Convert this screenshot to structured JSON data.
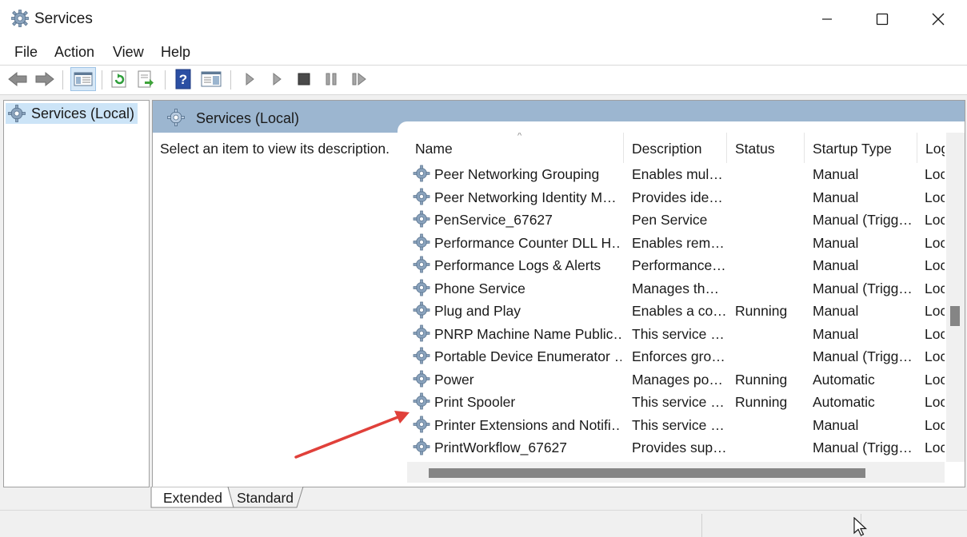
{
  "window": {
    "title": "Services",
    "title_icon": "gear-icon",
    "controls": [
      "minimize",
      "maximize",
      "close"
    ]
  },
  "menu": {
    "items": [
      {
        "label": "File"
      },
      {
        "label": "Action"
      },
      {
        "label": "View"
      },
      {
        "label": "Help"
      }
    ]
  },
  "toolbar": {
    "buttons": [
      "back-arrow-icon",
      "forward-arrow-icon",
      "show-hide-console-tree-icon",
      "refresh-icon",
      "export-list-icon",
      "help-icon",
      "properties-icon",
      "start-service-icon",
      "start-service-alt-icon",
      "stop-service-icon",
      "pause-service-icon",
      "resume-service-icon"
    ]
  },
  "tree": {
    "selected_label": "Services (Local)"
  },
  "main": {
    "header_label": "Services (Local)",
    "description_text": "Select an item to view its description.",
    "columns": {
      "name": "Name",
      "description": "Description",
      "status": "Status",
      "startup": "Startup Type",
      "logon": "Log"
    },
    "rows": [
      {
        "name": "Peer Networking Grouping",
        "description": "Enables mul…",
        "status": "",
        "startup": "Manual",
        "logon": "Loc"
      },
      {
        "name": "Peer Networking Identity M…",
        "description": "Provides ide…",
        "status": "",
        "startup": "Manual",
        "logon": "Loc"
      },
      {
        "name": "PenService_67627",
        "description": "Pen Service",
        "status": "",
        "startup": "Manual (Trigg…",
        "logon": "Loc"
      },
      {
        "name": "Performance Counter DLL H…",
        "description": "Enables rem…",
        "status": "",
        "startup": "Manual",
        "logon": "Loc"
      },
      {
        "name": "Performance Logs & Alerts",
        "description": "Performance…",
        "status": "",
        "startup": "Manual",
        "logon": "Loc"
      },
      {
        "name": "Phone Service",
        "description": "Manages th…",
        "status": "",
        "startup": "Manual (Trigg…",
        "logon": "Loc"
      },
      {
        "name": "Plug and Play",
        "description": "Enables a co…",
        "status": "Running",
        "startup": "Manual",
        "logon": "Loc"
      },
      {
        "name": "PNRP Machine Name Public…",
        "description": "This service …",
        "status": "",
        "startup": "Manual",
        "logon": "Loc"
      },
      {
        "name": "Portable Device Enumerator …",
        "description": "Enforces gro…",
        "status": "",
        "startup": "Manual (Trigg…",
        "logon": "Loc"
      },
      {
        "name": "Power",
        "description": "Manages po…",
        "status": "Running",
        "startup": "Automatic",
        "logon": "Loc"
      },
      {
        "name": "Print Spooler",
        "description": "This service …",
        "status": "Running",
        "startup": "Automatic",
        "logon": "Loc"
      },
      {
        "name": "Printer Extensions and Notifi…",
        "description": "This service …",
        "status": "",
        "startup": "Manual",
        "logon": "Loc"
      },
      {
        "name": "PrintWorkflow_67627",
        "description": "Provides sup…",
        "status": "",
        "startup": "Manual (Trigg…",
        "logon": "Loc"
      }
    ]
  },
  "tabs": [
    {
      "label": "Extended",
      "active": true
    },
    {
      "label": "Standard",
      "active": false
    }
  ],
  "colors": {
    "header_band": "#9cb6d0",
    "selection": "#cce4f7",
    "annotation_arrow": "#e0403a"
  }
}
